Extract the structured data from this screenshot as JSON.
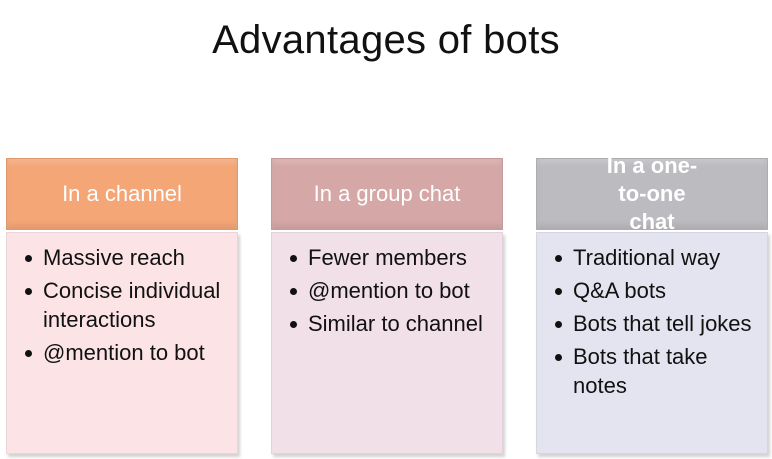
{
  "title": "Advantages of bots",
  "columns": [
    {
      "header": "In a channel",
      "header_color": "#F4A676",
      "body_color": "#FBE3E6",
      "items": [
        "Massive reach",
        "Concise individual interactions",
        "@mention to bot"
      ]
    },
    {
      "header": "In a group chat",
      "header_color": "#D5A7A6",
      "body_color": "#F1E0E7",
      "items": [
        "Fewer members",
        "@mention to bot",
        "Similar to channel"
      ]
    },
    {
      "header": "In a one-to-one chat",
      "header_color": "#BCBBC0",
      "body_color": "#E4E4F1",
      "items": [
        "Traditional way",
        "Q&A bots",
        "Bots that tell jokes",
        "Bots that take notes"
      ]
    }
  ]
}
